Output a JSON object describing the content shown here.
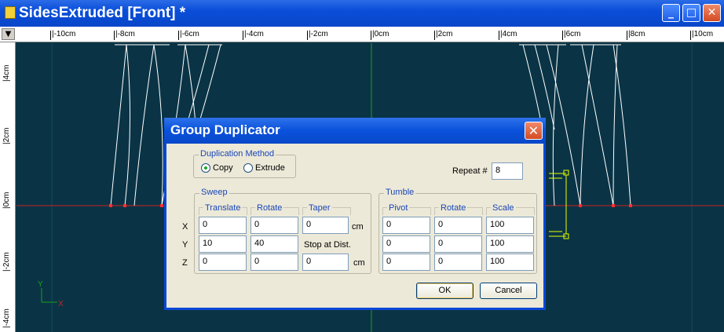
{
  "window": {
    "title": "SidesExtruded [Front] *"
  },
  "ruler_top": {
    "corner": "▼",
    "ticks": [
      "|-10cm",
      "|-8cm",
      "|-6cm",
      "|-4cm",
      "|-2cm",
      "|0cm",
      "|2cm",
      "|4cm",
      "|6cm",
      "|8cm",
      "|10cm"
    ]
  },
  "ruler_left": {
    "ticks": [
      "|4cm",
      "|2cm",
      "|0cm",
      "|-2cm",
      "|-4cm"
    ]
  },
  "axes": {
    "y": "Y",
    "x": "X"
  },
  "colors": {
    "viewport_bg": "#0a3446",
    "axis_red": "#cc2020",
    "axis_green": "#19a019",
    "wire": "#ffffff",
    "selection": "#e6ff00"
  },
  "dialog": {
    "title": "Group Duplicator",
    "duplication_method": {
      "label": "Duplication Method",
      "copy": "Copy",
      "extrude": "Extrude",
      "selected": "Copy"
    },
    "repeat": {
      "label": "Repeat #",
      "value": "8"
    },
    "sweep": {
      "label": "Sweep",
      "translate": "Translate",
      "rotate": "Rotate",
      "taper": "Taper",
      "translate_values": [
        "0",
        "10",
        "0"
      ],
      "rotate_values": [
        "0",
        "40",
        "0"
      ],
      "taper_x": "0",
      "taper_z": "0",
      "stop_at_dist": "Stop at Dist.",
      "unit_cm_x": "cm",
      "unit_cm_z": "cm"
    },
    "row_labels": [
      "X",
      "Y",
      "Z"
    ],
    "tumble": {
      "label": "Tumble",
      "pivot": "Pivot",
      "rotate": "Rotate",
      "scale": "Scale",
      "pivot_values": [
        "0",
        "0",
        "0"
      ],
      "rotate_values": [
        "0",
        "0",
        "0"
      ],
      "scale_values": [
        "100",
        "100",
        "100"
      ]
    },
    "ok": "OK",
    "cancel": "Cancel"
  }
}
